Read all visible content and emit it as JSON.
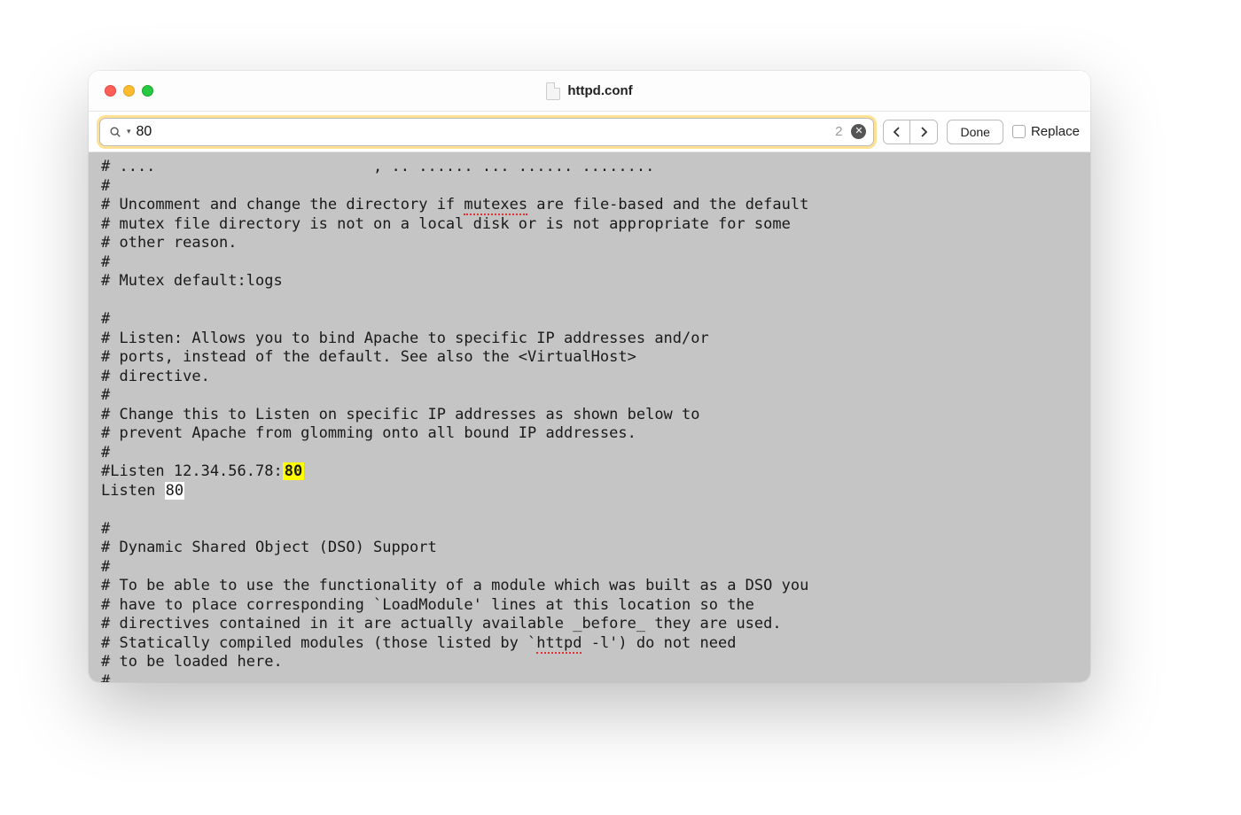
{
  "window": {
    "title": "httpd.conf"
  },
  "findbar": {
    "query": "80",
    "result_count": "2",
    "done_label": "Done",
    "replace_label": "Replace"
  },
  "editor": {
    "lines": [
      "# ....                        , .. ...... ... ...... ........",
      "#",
      "# Uncomment and change the directory if mutexes are file-based and the default",
      "# mutex file directory is not on a local disk or is not appropriate for some",
      "# other reason.",
      "#",
      "# Mutex default:logs",
      "",
      "#",
      "# Listen: Allows you to bind Apache to specific IP addresses and/or",
      "# ports, instead of the default. See also the <VirtualHost>",
      "# directive.",
      "#",
      "# Change this to Listen on specific IP addresses as shown below to",
      "# prevent Apache from glomming onto all bound IP addresses.",
      "#",
      "#Listen 12.34.56.78:80",
      "Listen 80",
      "",
      "#",
      "# Dynamic Shared Object (DSO) Support",
      "#",
      "# To be able to use the functionality of a module which was built as a DSO you",
      "# have to place corresponding `LoadModule' lines at this location so the",
      "# directives contained in it are actually available _before_ they are used.",
      "# Statically compiled modules (those listed by `httpd -l') do not need",
      "# to be loaded here.",
      "#"
    ],
    "search_term": "80",
    "spell_errors": [
      "mutexes",
      "httpd"
    ],
    "current_match_line": 16
  }
}
